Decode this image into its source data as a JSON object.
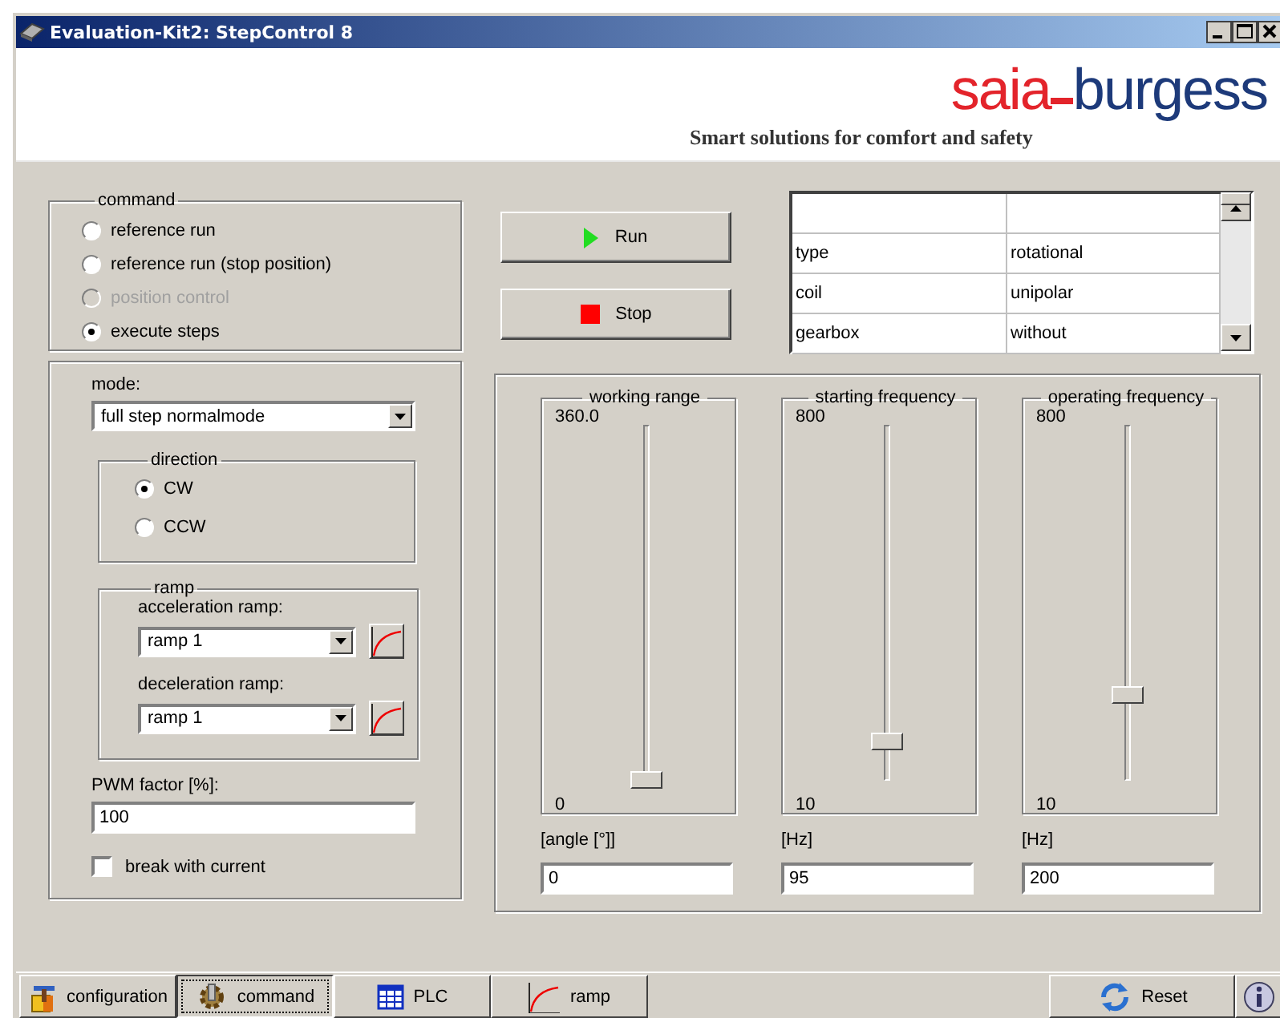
{
  "window": {
    "title": "Evaluation-Kit2: StepControl 8"
  },
  "header": {
    "logo_left": "saia",
    "logo_right": "burgess",
    "tagline": "Smart solutions for comfort and safety"
  },
  "command": {
    "title": "command",
    "options": [
      {
        "label": "reference run",
        "selected": false,
        "disabled": false
      },
      {
        "label": "reference run (stop position)",
        "selected": false,
        "disabled": false
      },
      {
        "label": "position control",
        "selected": false,
        "disabled": true
      },
      {
        "label": "execute steps",
        "selected": true,
        "disabled": false
      }
    ]
  },
  "mode": {
    "label": "mode:",
    "value": "full step normalmode"
  },
  "direction": {
    "title": "direction",
    "options": [
      {
        "label": "CW",
        "selected": true
      },
      {
        "label": "CCW",
        "selected": false
      }
    ]
  },
  "ramp": {
    "title": "ramp",
    "selectors": [
      {
        "label": "acceleration ramp:",
        "value": "ramp 1"
      },
      {
        "label": "deceleration ramp:",
        "value": "ramp 1"
      }
    ]
  },
  "pwm": {
    "label": "PWM factor [%]:",
    "value": "100"
  },
  "break_with_current": {
    "label": "break with current",
    "checked": false
  },
  "buttons": [
    {
      "label": "Run",
      "kind": "run"
    },
    {
      "label": "Stop",
      "kind": "stop"
    }
  ],
  "motor_table": {
    "rows": [
      {
        "column_1": "type",
        "column_2": "rotational"
      },
      {
        "column_1": "coil",
        "column_2": "unipolar"
      },
      {
        "column_1": "gearbox",
        "column_2": "without"
      }
    ]
  },
  "sliders": [
    {
      "title": "working range",
      "max": "360.0",
      "min": "0",
      "level": 0,
      "unit": "[angle [°]]",
      "value": "0"
    },
    {
      "title": "starting frequency",
      "max": "800",
      "min": "10",
      "level": 0.11,
      "unit": "[Hz]",
      "value": "95"
    },
    {
      "title": "operating frequency",
      "max": "800",
      "min": "10",
      "level": 0.24,
      "unit": "[Hz]",
      "value": "200"
    }
  ],
  "tabs": [
    {
      "label": "configuration",
      "kind": "configuration",
      "selected": false
    },
    {
      "label": "command",
      "kind": "command",
      "selected": true
    },
    {
      "label": "PLC",
      "kind": "plc",
      "selected": false
    },
    {
      "label": "ramp",
      "kind": "ramp",
      "selected": false
    }
  ],
  "reset": {
    "label": "Reset"
  }
}
